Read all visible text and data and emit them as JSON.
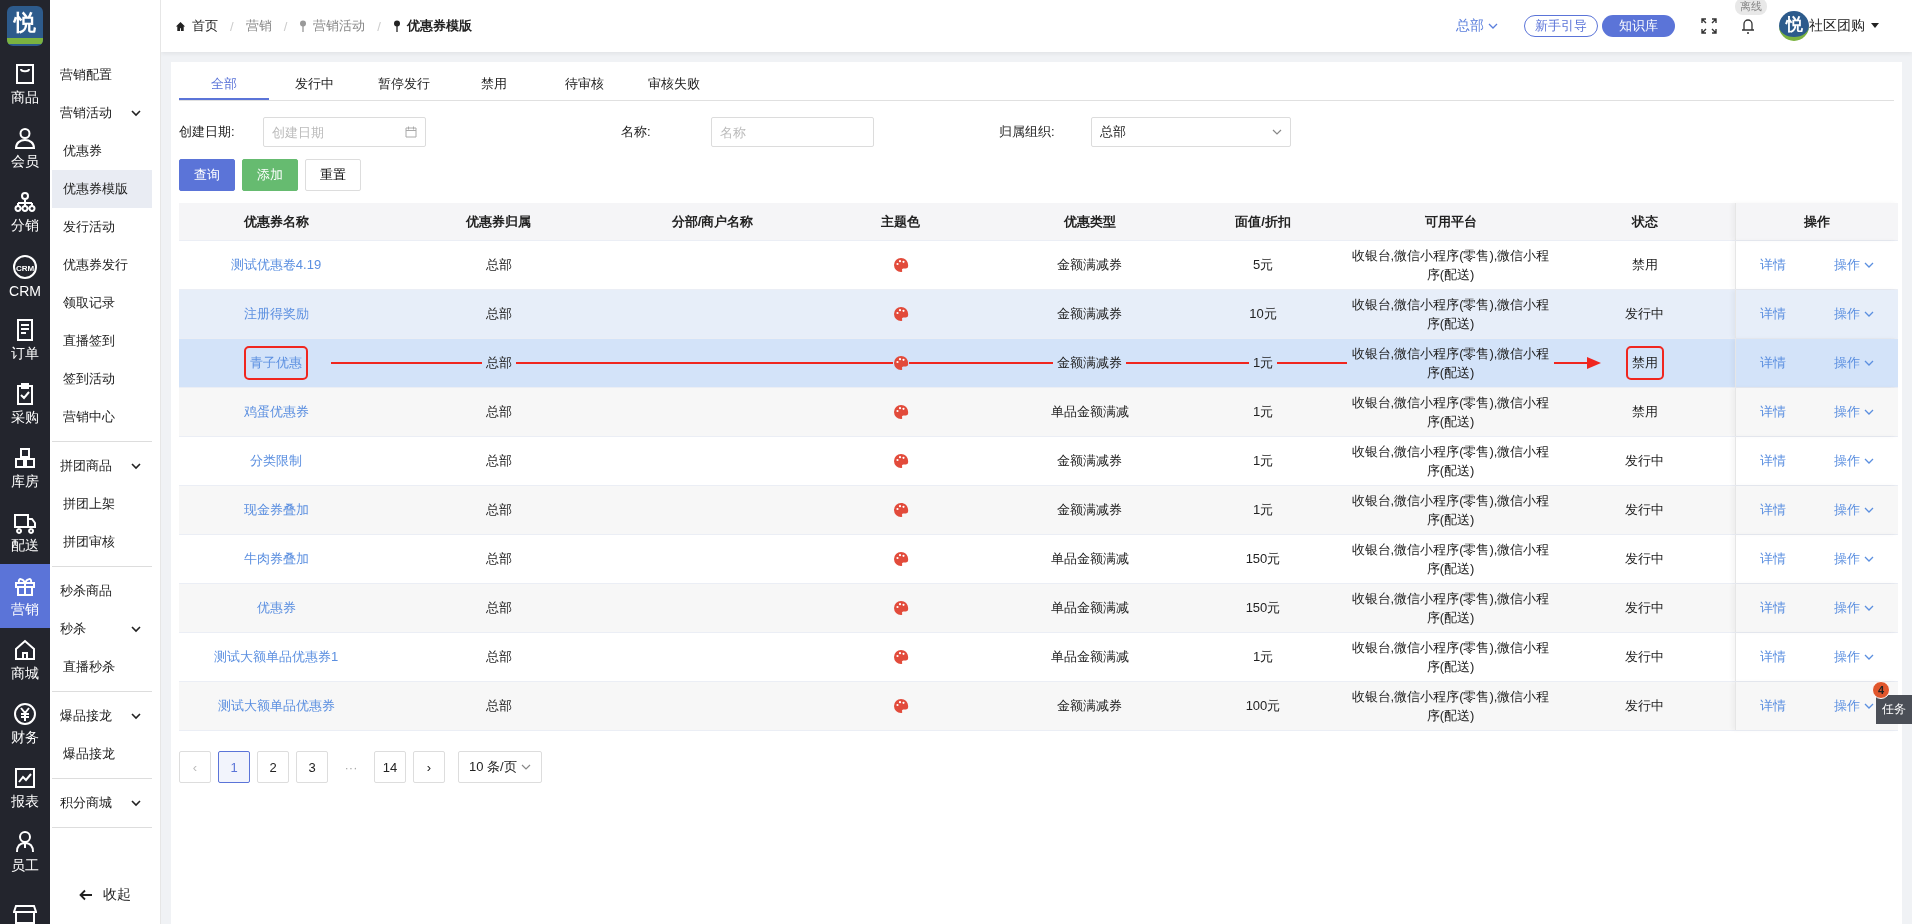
{
  "logo": {
    "char": "悦"
  },
  "rail": [
    {
      "label": "商品",
      "selected": false
    },
    {
      "label": "会员",
      "selected": false
    },
    {
      "label": "分销",
      "selected": false
    },
    {
      "label": "CRM",
      "badge": "CRM",
      "selected": false
    },
    {
      "label": "订单",
      "selected": false
    },
    {
      "label": "采购",
      "selected": false
    },
    {
      "label": "库房",
      "selected": false
    },
    {
      "label": "配送",
      "selected": false
    },
    {
      "label": "营销",
      "selected": true
    },
    {
      "label": "商城",
      "selected": false
    },
    {
      "label": "财务",
      "selected": false
    },
    {
      "label": "报表",
      "selected": false
    },
    {
      "label": "员工",
      "selected": false
    },
    {
      "kind": "cut",
      "selected": false
    }
  ],
  "sidebar": {
    "sections": [
      {
        "items": [
          {
            "label": "营销配置",
            "kind": "link",
            "selected": false
          },
          {
            "label": "营销活动",
            "kind": "group",
            "expanded": true,
            "children": [
              {
                "label": "优惠券",
                "selected": false
              },
              {
                "label": "优惠券模版",
                "selected": true
              },
              {
                "label": "发行活动",
                "selected": false
              },
              {
                "label": "优惠券发行",
                "selected": false
              },
              {
                "label": "领取记录",
                "selected": false
              },
              {
                "label": "直播签到",
                "selected": false
              },
              {
                "label": "签到活动",
                "selected": false
              },
              {
                "label": "营销中心",
                "selected": false
              }
            ]
          }
        ]
      },
      {
        "items": [
          {
            "label": "拼团商品",
            "kind": "group",
            "expanded": true,
            "children": [
              {
                "label": "拼团上架",
                "selected": false
              },
              {
                "label": "拼团审核",
                "selected": false
              }
            ]
          }
        ]
      },
      {
        "items": [
          {
            "label": "秒杀商品",
            "kind": "link",
            "selected": false
          },
          {
            "label": "秒杀",
            "kind": "group",
            "expanded": true,
            "children": [
              {
                "label": "直播秒杀",
                "selected": false
              }
            ]
          }
        ]
      },
      {
        "items": [
          {
            "label": "爆品接龙",
            "kind": "group",
            "expanded": true,
            "children": [
              {
                "label": "爆品接龙",
                "selected": false
              }
            ]
          }
        ]
      },
      {
        "items": [
          {
            "label": "积分商城",
            "kind": "group",
            "expanded": true
          }
        ]
      }
    ],
    "collapse": "收起"
  },
  "breadcrumb": [
    {
      "label": "首页",
      "kind": "home"
    },
    {
      "sep": "/",
      "label": "营销",
      "kind": "plain"
    },
    {
      "sep": "/",
      "label": "营销活动",
      "kind": "pin"
    },
    {
      "sep": "/",
      "label": "优惠券模版",
      "kind": "current"
    }
  ],
  "header": {
    "org": "总部",
    "guide": "新手引导",
    "kb": "知识库",
    "status_tip": "离线",
    "avatar_char": "悦",
    "user": "社区团购"
  },
  "tabs": [
    {
      "label": "全部",
      "selected": true
    },
    {
      "label": "发行中",
      "selected": false
    },
    {
      "label": "暂停发行",
      "selected": false
    },
    {
      "label": "禁用",
      "selected": false
    },
    {
      "label": "待审核",
      "selected": false
    },
    {
      "label": "审核失败",
      "selected": false
    }
  ],
  "filters": [
    {
      "label": "创建日期:",
      "kind": "date",
      "placeholder": "创建日期"
    },
    {
      "label": "名称:",
      "kind": "text",
      "placeholder": "名称"
    },
    {
      "label": "归属组织:",
      "kind": "select",
      "value": "总部"
    }
  ],
  "buttons": [
    {
      "label": "查询",
      "kind": "primary"
    },
    {
      "label": "添加",
      "kind": "success"
    },
    {
      "label": "重置",
      "kind": "default"
    }
  ],
  "table": {
    "columns": [
      "优惠券名称",
      "优惠券归属",
      "分部/商户名称",
      "主题色",
      "优惠类型",
      "面值/折扣",
      "可用平台",
      "状态",
      "操作"
    ],
    "rows": [
      {
        "name": "测试优惠卷4.19",
        "owner": "总部",
        "type": "金额满减券",
        "value": "5元",
        "platform": "收银台,微信小程序(零售),微信小程序(配送)",
        "status": "禁用",
        "detail": "详情",
        "action": "操作",
        "hovered": false,
        "selected": false,
        "marked": false
      },
      {
        "name": "注册得奖励",
        "owner": "总部",
        "type": "金额满减券",
        "value": "10元",
        "platform": "收银台,微信小程序(零售),微信小程序(配送)",
        "status": "发行中",
        "detail": "详情",
        "action": "操作",
        "hovered": true,
        "selected": false,
        "marked": false
      },
      {
        "name": "青子优惠",
        "owner": "总部",
        "type": "金额满减券",
        "value": "1元",
        "platform": "收银台,微信小程序(零售),微信小程序(配送)",
        "status": "禁用",
        "detail": "详情",
        "action": "操作",
        "hovered": false,
        "selected": true,
        "marked": true
      },
      {
        "name": "鸡蛋优惠券",
        "owner": "总部",
        "type": "单品金额满减",
        "value": "1元",
        "platform": "收银台,微信小程序(零售),微信小程序(配送)",
        "status": "禁用",
        "detail": "详情",
        "action": "操作",
        "hovered": false,
        "selected": false,
        "marked": false
      },
      {
        "name": "分类限制",
        "owner": "总部",
        "type": "金额满减券",
        "value": "1元",
        "platform": "收银台,微信小程序(零售),微信小程序(配送)",
        "status": "发行中",
        "detail": "详情",
        "action": "操作",
        "hovered": false,
        "selected": false,
        "marked": false
      },
      {
        "name": "现金券叠加",
        "owner": "总部",
        "type": "金额满减券",
        "value": "1元",
        "platform": "收银台,微信小程序(零售),微信小程序(配送)",
        "status": "发行中",
        "detail": "详情",
        "action": "操作",
        "hovered": false,
        "selected": false,
        "marked": false
      },
      {
        "name": "牛肉券叠加",
        "owner": "总部",
        "type": "单品金额满减",
        "value": "150元",
        "platform": "收银台,微信小程序(零售),微信小程序(配送)",
        "status": "发行中",
        "detail": "详情",
        "action": "操作",
        "hovered": false,
        "selected": false,
        "marked": false
      },
      {
        "name": "优惠券",
        "owner": "总部",
        "type": "单品金额满减",
        "value": "150元",
        "platform": "收银台,微信小程序(零售),微信小程序(配送)",
        "status": "发行中",
        "detail": "详情",
        "action": "操作",
        "hovered": false,
        "selected": false,
        "marked": false
      },
      {
        "name": "测试大额单品优惠券1",
        "owner": "总部",
        "type": "单品金额满减",
        "value": "1元",
        "platform": "收银台,微信小程序(零售),微信小程序(配送)",
        "status": "发行中",
        "detail": "详情",
        "action": "操作",
        "hovered": false,
        "selected": false,
        "marked": false
      },
      {
        "name": "测试大额单品优惠券",
        "owner": "总部",
        "type": "金额满减券",
        "value": "100元",
        "platform": "收银台,微信小程序(零售),微信小程序(配送)",
        "status": "发行中",
        "detail": "详情",
        "action": "操作",
        "hovered": false,
        "selected": false,
        "marked": false
      }
    ]
  },
  "pagination": {
    "prev": "‹",
    "next": "›",
    "pages": [
      {
        "label": "1",
        "kind": "page",
        "selected": true
      },
      {
        "label": "2",
        "kind": "page",
        "selected": false
      },
      {
        "label": "3",
        "kind": "page",
        "selected": false
      },
      {
        "label": "···",
        "kind": "ellipsis"
      },
      {
        "label": "14",
        "kind": "page",
        "selected": false
      }
    ],
    "page_size": "10 条/页"
  },
  "task": {
    "label": "任务",
    "count": "4"
  }
}
